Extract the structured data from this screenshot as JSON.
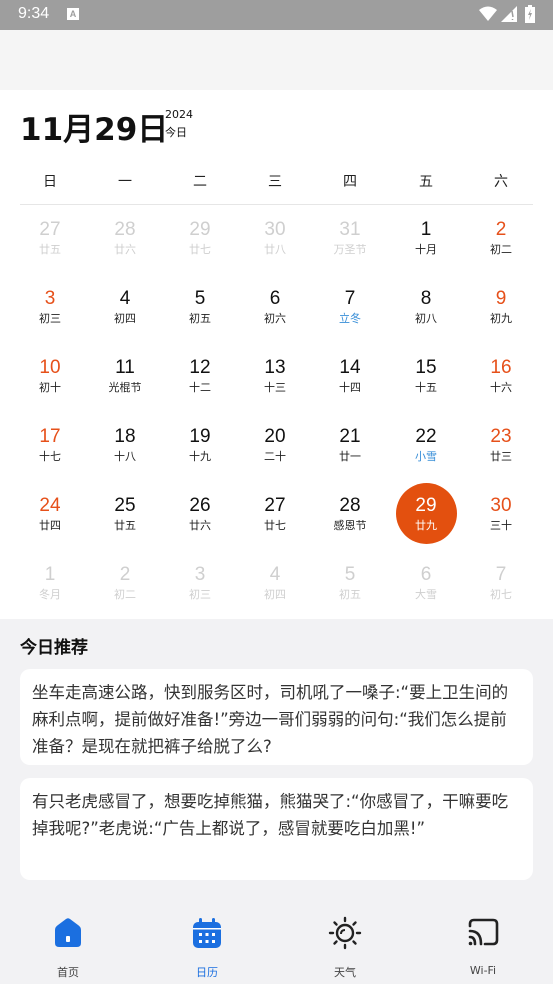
{
  "status_bar": {
    "time": "9:34",
    "notification_icon": "A"
  },
  "header": {
    "date_title": "11月29日",
    "year": "2024",
    "today_label": "今日"
  },
  "calendar": {
    "weekdays": [
      "日",
      "一",
      "二",
      "三",
      "四",
      "五",
      "六"
    ],
    "weeks": [
      [
        {
          "d": "27",
          "l": "廿五",
          "muted": true
        },
        {
          "d": "28",
          "l": "廿六",
          "muted": true
        },
        {
          "d": "29",
          "l": "廿七",
          "muted": true
        },
        {
          "d": "30",
          "l": "廿八",
          "muted": true
        },
        {
          "d": "31",
          "l": "万圣节",
          "muted": true
        },
        {
          "d": "1",
          "l": "十月"
        },
        {
          "d": "2",
          "l": "初二",
          "weekend": true
        }
      ],
      [
        {
          "d": "3",
          "l": "初三",
          "weekend": true
        },
        {
          "d": "4",
          "l": "初四"
        },
        {
          "d": "5",
          "l": "初五"
        },
        {
          "d": "6",
          "l": "初六"
        },
        {
          "d": "7",
          "l": "立冬",
          "term": true
        },
        {
          "d": "8",
          "l": "初八"
        },
        {
          "d": "9",
          "l": "初九",
          "weekend": true
        }
      ],
      [
        {
          "d": "10",
          "l": "初十",
          "weekend": true
        },
        {
          "d": "11",
          "l": "光棍节"
        },
        {
          "d": "12",
          "l": "十二"
        },
        {
          "d": "13",
          "l": "十三"
        },
        {
          "d": "14",
          "l": "十四"
        },
        {
          "d": "15",
          "l": "十五"
        },
        {
          "d": "16",
          "l": "十六",
          "weekend": true
        }
      ],
      [
        {
          "d": "17",
          "l": "十七",
          "weekend": true
        },
        {
          "d": "18",
          "l": "十八"
        },
        {
          "d": "19",
          "l": "十九"
        },
        {
          "d": "20",
          "l": "二十"
        },
        {
          "d": "21",
          "l": "廿一"
        },
        {
          "d": "22",
          "l": "小雪",
          "term": true
        },
        {
          "d": "23",
          "l": "廿三",
          "weekend": true
        }
      ],
      [
        {
          "d": "24",
          "l": "廿四",
          "weekend": true
        },
        {
          "d": "25",
          "l": "廿五"
        },
        {
          "d": "26",
          "l": "廿六"
        },
        {
          "d": "27",
          "l": "廿七"
        },
        {
          "d": "28",
          "l": "感恩节"
        },
        {
          "d": "29",
          "l": "廿九",
          "selected": true
        },
        {
          "d": "30",
          "l": "三十",
          "weekend": true
        }
      ],
      [
        {
          "d": "1",
          "l": "冬月",
          "muted": true
        },
        {
          "d": "2",
          "l": "初二",
          "muted": true
        },
        {
          "d": "3",
          "l": "初三",
          "muted": true
        },
        {
          "d": "4",
          "l": "初四",
          "muted": true
        },
        {
          "d": "5",
          "l": "初五",
          "muted": true
        },
        {
          "d": "6",
          "l": "大雪",
          "muted": true
        },
        {
          "d": "7",
          "l": "初七",
          "muted": true
        }
      ]
    ],
    "colors": {
      "weekend": "#e6501a",
      "solar_term": "#3a8fd8",
      "selected_bg": "#e3500f",
      "muted": "#cfcfcf"
    }
  },
  "recommend": {
    "title": "今日推荐",
    "items": [
      "坐车走高速公路，快到服务区时，司机吼了一嗓子:“要上卫生间的麻利点啊，提前做好准备!”旁边一哥们弱弱的问句:“我们怎么提前准备？是现在就把裤子给脱了么?",
      "有只老虎感冒了，想要吃掉熊猫，熊猫哭了:“你感冒了，干嘛要吃掉我呢?”老虎说:“广告上都说了，感冒就要吃白加黑!”"
    ]
  },
  "bottom_nav": {
    "items": [
      {
        "label": "首页",
        "icon": "home-icon"
      },
      {
        "label": "日历",
        "icon": "calendar-icon",
        "active": true
      },
      {
        "label": "天气",
        "icon": "sun-icon"
      },
      {
        "label": "Wi-Fi",
        "icon": "cast-icon"
      }
    ],
    "active_color": "#1b6fe0"
  }
}
